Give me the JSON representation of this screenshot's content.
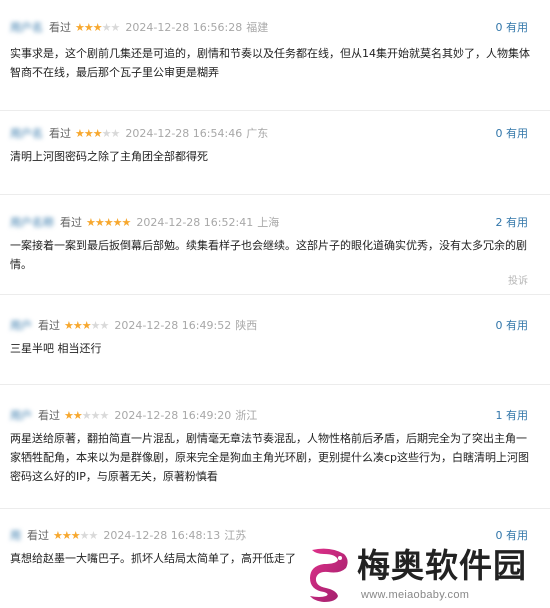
{
  "comments": [
    {
      "user": "用户名",
      "watched": "看过",
      "rating": 3,
      "time": "2024-12-28 16:56:28",
      "location": "福建",
      "useful_count": "0",
      "useful_label": "有用",
      "text": "实事求是，这个剧前几集还是可追的，剧情和节奏以及任务都在线，但从14集开始就莫名其妙了，人物集体智商不在线，最后那个瓦子里公审更是糊弄"
    },
    {
      "user": "用户名",
      "watched": "看过",
      "rating": 3,
      "time": "2024-12-28 16:54:46",
      "location": "广东",
      "useful_count": "0",
      "useful_label": "有用",
      "text": "清明上河图密码之除了主角团全部都得死"
    },
    {
      "user": "用户名称",
      "watched": "看过",
      "rating": 5,
      "time": "2024-12-28 16:52:41",
      "location": "上海",
      "useful_count": "2",
      "useful_label": "有用",
      "text": "一案接着一案到最后扳倒幕后部勉。续集看样子也会继续。这部片子的眼化道确实优秀，没有太多冗余的剧情。",
      "report": "投诉"
    },
    {
      "user": "用户",
      "watched": "看过",
      "rating": 3,
      "time": "2024-12-28 16:49:52",
      "location": "陕西",
      "useful_count": "0",
      "useful_label": "有用",
      "text": "三星半吧 相当还行"
    },
    {
      "user": "用户",
      "watched": "看过",
      "rating": 2,
      "time": "2024-12-28 16:49:20",
      "location": "浙江",
      "useful_count": "1",
      "useful_label": "有用",
      "text": "两星送给原著，翻拍简直一片混乱，剧情毫无章法节奏混乱，人物性格前后矛盾，后期完全为了突出主角一家牺牲配角，本来以为是群像剧，原来完全是狗血主角光环剧，更别提什么凑cp这些行为，白瞎清明上河图密码这么好的IP，与原著无关，原著粉慎看"
    },
    {
      "user": "用",
      "watched": "看过",
      "rating": 3,
      "time": "2024-12-28 16:48:13",
      "location": "江苏",
      "useful_count": "0",
      "useful_label": "有用",
      "text": "真想给赵墨一大嘴巴子。抓坏人结局太简单了，高开低走了"
    }
  ],
  "watermark": {
    "title": "梅奥软件园",
    "url": "www.meiaobaby.com"
  },
  "colors": {
    "link": "#3377aa",
    "star_on": "#f7a82f",
    "star_off": "#d9d9d9",
    "meta_gray": "#a8a8a8"
  }
}
